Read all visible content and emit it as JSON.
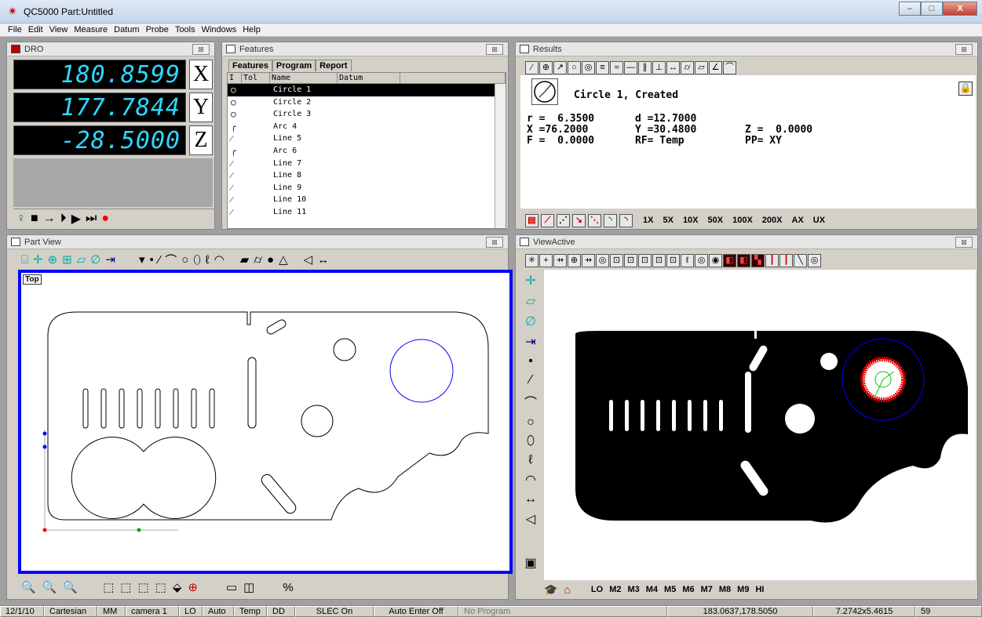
{
  "window": {
    "title": "QC5000 Part:Untitled",
    "minimize": "–",
    "maximize": "□",
    "close": "X"
  },
  "menu": [
    "File",
    "Edit",
    "View",
    "Measure",
    "Datum",
    "Probe",
    "Tools",
    "Windows",
    "Help"
  ],
  "dro": {
    "title": "DRO",
    "rows": [
      {
        "value": "180.8599",
        "axis": "X"
      },
      {
        "value": "177.7844",
        "axis": "Y"
      },
      {
        "value": "-28.5000",
        "axis": "Z"
      }
    ]
  },
  "features": {
    "title": "Features",
    "tabs": [
      "Features",
      "Program",
      "Report"
    ],
    "columns": [
      "I",
      "Tol",
      "Name",
      "Datum"
    ],
    "rows": [
      {
        "icon": "circle",
        "name": "Circle 1",
        "selected": true
      },
      {
        "icon": "circle",
        "name": "Circle 2",
        "selected": false
      },
      {
        "icon": "circle",
        "name": "Circle 3",
        "selected": false
      },
      {
        "icon": "arc",
        "name": "Arc 4",
        "selected": false
      },
      {
        "icon": "line",
        "name": "Line 5",
        "selected": false
      },
      {
        "icon": "arc",
        "name": "Arc 6",
        "selected": false
      },
      {
        "icon": "line",
        "name": "Line 7",
        "selected": false
      },
      {
        "icon": "line",
        "name": "Line 8",
        "selected": false
      },
      {
        "icon": "line",
        "name": "Line 9",
        "selected": false
      },
      {
        "icon": "line",
        "name": "Line 10",
        "selected": false
      },
      {
        "icon": "line",
        "name": "Line 11",
        "selected": false
      }
    ]
  },
  "results": {
    "title": "Results",
    "heading": "Circle 1, Created",
    "lines": [
      [
        "r =  6.3500",
        "d =12.7000",
        ""
      ],
      [
        "X =76.2000",
        "Y =30.4800",
        "Z =  0.0000"
      ],
      [
        "F =  0.0000",
        "RF= Temp",
        "PP= XY"
      ]
    ],
    "zoom": [
      "1X",
      "5X",
      "10X",
      "50X",
      "100X",
      "200X",
      "AX",
      "UX"
    ]
  },
  "partview": {
    "title": "Part View",
    "view_label": "Top",
    "percent": "%"
  },
  "viewactive": {
    "title": "ViewActive",
    "lenses": [
      "LO",
      "M2",
      "M3",
      "M4",
      "M5",
      "M6",
      "M7",
      "M8",
      "M9",
      "HI"
    ]
  },
  "status": [
    "12/1/10",
    "Cartesian",
    "MM",
    "camera 1",
    "LO",
    "Auto",
    "Temp",
    "DD",
    "SLEC On",
    "Auto Enter Off",
    "No Program",
    "183.0637,178.5050",
    "7.2742x5.4615",
    "59"
  ],
  "colors": {
    "dro_text": "#2fd8ff",
    "part_frame": "#0000ff",
    "circle_fit": "#0000ff",
    "edge_red": "#ff0000"
  }
}
